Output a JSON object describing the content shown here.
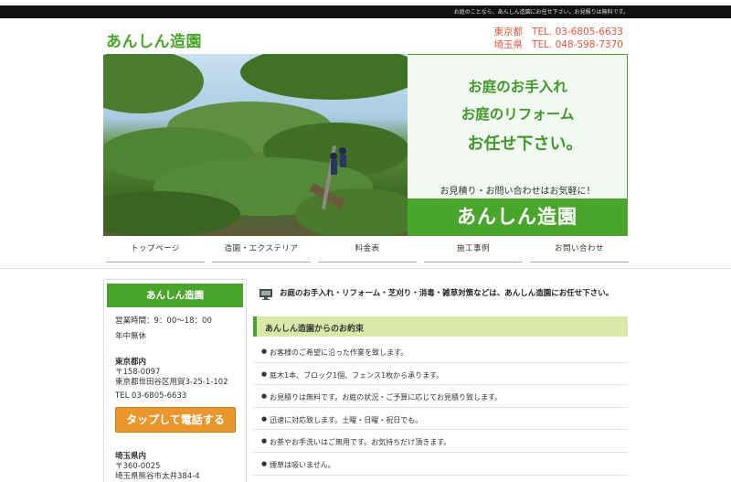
{
  "topbar": {
    "message": "お庭のことなら、あんしん造園にお任せ下さい。お見積りは無料です。"
  },
  "header": {
    "logo": "あんしん造園",
    "tel_lines": [
      {
        "pref": "東京都",
        "tel": "TEL. 03-6805-6633"
      },
      {
        "pref": "埼玉県",
        "tel": "TEL. 048-598-7370"
      }
    ]
  },
  "hero": {
    "line1": "お庭のお手入れ",
    "line2": "お庭のリフォーム",
    "line3": "お任せ下さい。",
    "sub": "お見積り・お問い合わせはお気軽に！",
    "band": "あんしん造園"
  },
  "nav": {
    "items": [
      "トップページ",
      "造園・エクステリア",
      "料金表",
      "施工事例",
      "お問い合わせ"
    ]
  },
  "sidebar": {
    "title": "あんしん造園",
    "hours": "営業時間：9：00～18：00",
    "holiday": "年中無休",
    "tokyo_label": "東京都内",
    "tokyo_zip": "〒158-0097",
    "tokyo_addr": "東京都世田谷区用賀3-25-1-102",
    "tokyo_tel": "TEL 03-6805-6633",
    "call_button": "タップして電話する",
    "saitama_label": "埼玉県内",
    "saitama_zip": "〒360-0025",
    "saitama_addr": "埼玉県熊谷市太井384-4"
  },
  "main": {
    "intro": "お庭のお手入れ・リフォーム・芝刈り・消毒・雑草対策などは、あんしん造園にお任せ下さい。",
    "promise_title": "あんしん造園からのお約束",
    "promises": [
      "お客様のご希望に沿った作業を致します。",
      "庭木1本、ブロック1個、フェンス1枚から承ります。",
      "お見積りは無料です。お庭の状況・ご予算に応じてお見積り致します。",
      "迅速に対応致します。土曜・日曜・祝日でも。",
      "お茶やお手洗いはご無用です。お気持ちだけ頂きます。",
      "煙草は吸いません。"
    ]
  },
  "colors": {
    "accent_green": "#4aa52c",
    "tel_orange": "#e2573a",
    "button_orange": "#e9962c",
    "promise_bg": "#d9e8a6"
  },
  "icons": {
    "intro_icon": "monitor-icon"
  }
}
